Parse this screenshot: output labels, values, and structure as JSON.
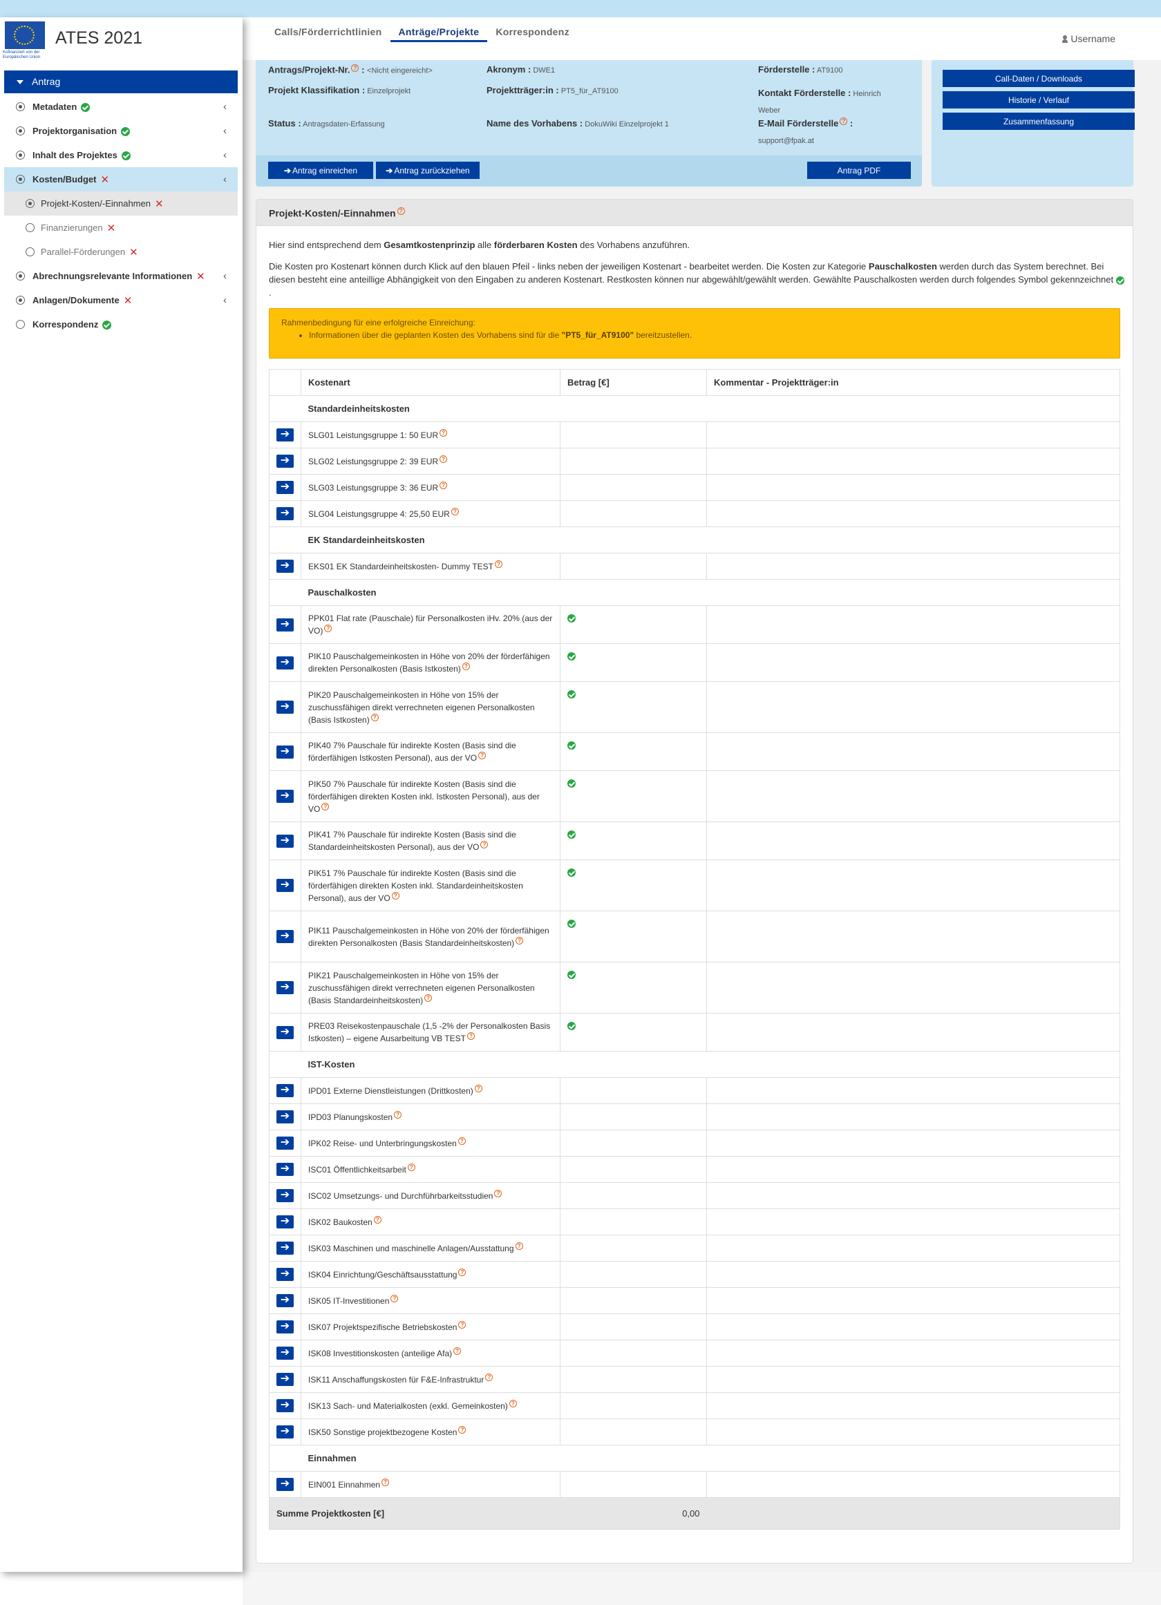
{
  "app": {
    "title": "ATES 2021",
    "logo_caption": "Kofinanziert von der Europäischen Union"
  },
  "tabs": [
    {
      "label": "Calls/Förderrichtlinien"
    },
    {
      "label": "Anträge/Projekte"
    },
    {
      "label": "Korrespondenz"
    }
  ],
  "user": {
    "name": "Username"
  },
  "sidebar": {
    "items": [
      {
        "label": "Antrag"
      },
      {
        "label": "Metadaten"
      },
      {
        "label": "Projektorganisation"
      },
      {
        "label": "Inhalt des Projektes"
      },
      {
        "label": "Kosten/Budget"
      },
      {
        "label": "Projekt-Kosten/-Einnahmen"
      },
      {
        "label": "Finanzierungen"
      },
      {
        "label": "Parallel-Förderungen"
      },
      {
        "label": "Abrechnungsrelevante Informationen"
      },
      {
        "label": "Anlagen/Dokumente"
      },
      {
        "label": "Korrespondenz"
      }
    ]
  },
  "info": {
    "antrag_nr_label": "Antrags/Projekt-Nr.",
    "antrag_nr_value": "<Nicht eingereicht>",
    "akronym_label": "Akronym :",
    "akronym_value": "DWE1",
    "foerderstelle_label": "Förderstelle :",
    "foerderstelle_value": "AT9100",
    "klassifikation_label": "Projekt Klassifikation :",
    "klassifikation_value": "Einzelprojekt",
    "traeger_label": "Projektträger:in :",
    "traeger_value": "PT5_für_AT9100",
    "kontakt_label": "Kontakt Förderstelle :",
    "kontakt_value_1": "Heinrich",
    "kontakt_value_2": "Weber",
    "status_label": "Status :",
    "status_value": "Antragsdaten-Erfassung",
    "vorhaben_label": "Name des Vorhabens :",
    "vorhaben_value": "DokuWiki Einzelprojekt 1",
    "email_label": "E-Mail Förderstelle",
    "email_value": "support@fpak.at",
    "btn_einreichen": "Antrag einreichen",
    "btn_zurueckziehen": "Antrag zurückziehen",
    "btn_pdf": "Antrag PDF",
    "side_buttons": [
      "Call-Daten / Downloads",
      "Historie / Verlauf",
      "Zusammenfassung"
    ]
  },
  "panel": {
    "title": "Projekt-Kosten/-Einnahmen",
    "intro1_a": "Hier sind entsprechend dem ",
    "intro1_b": "Gesamtkostenprinzip",
    "intro1_c": " alle ",
    "intro1_d": "förderbaren Kosten",
    "intro1_e": " des Vorhabens anzuführen.",
    "intro2_a": "Die Kosten pro Kostenart können durch Klick auf den blauen Pfeil - links neben der jeweiligen Kostenart - bearbeitet werden. Die Kosten zur Kategorie ",
    "intro2_b": "Pauschalkosten",
    "intro2_c": " werden durch das System berechnet. Bei diesen besteht eine anteillige Abhängigkeit von den Eingaben zu anderen Kostenart. Restkosten können nur abgewählt/gewählt werden. Gewählte Pauschalkosten werden durch folgendes Symbol gekennzeichnet",
    "alert_title": "Rahmenbedingung für eine erfolgreiche Einreichung:",
    "alert_item_a": "Informationen über die geplanten Kosten des Vorhabens sind für die ",
    "alert_item_b": "\"PT5_für_AT9100\"",
    "alert_item_c": " bereitzustellen."
  },
  "table": {
    "headers": [
      "Kostenart",
      "Betrag [€]",
      "Kommentar - Projektträger:in"
    ],
    "groups": [
      {
        "title": "Standardeinheitskosten",
        "rows": [
          {
            "text": "SLG01 Leistungsgruppe 1: 50 EUR",
            "ok": false
          },
          {
            "text": "SLG02 Leistungsgruppe 2: 39 EUR",
            "ok": false
          },
          {
            "text": "SLG03 Leistungsgruppe 3: 36 EUR",
            "ok": false
          },
          {
            "text": "SLG04 Leistungsgruppe 4: 25,50 EUR",
            "ok": false
          }
        ]
      },
      {
        "title": "EK Standardeinheitskosten",
        "rows": [
          {
            "text": "EKS01 EK Standardeinheitskosten- Dummy TEST",
            "ok": false
          }
        ]
      },
      {
        "title": "Pauschalkosten",
        "rows": [
          {
            "text": "PPK01 Flat rate (Pauschale) für Personalkosten iHv. 20% (aus der VO)",
            "ok": true
          },
          {
            "text": "PIK10 Pauschalgemeinkosten in Höhe von 20% der förderfähigen direkten Personalkosten (Basis Istkosten)",
            "ok": true
          },
          {
            "text": "PIK20 Pauschalgemeinkosten in Höhe von 15% der zuschussfähigen direkt verrechneten eigenen Personalkosten (Basis Istkosten)",
            "ok": true
          },
          {
            "text": "PIK40 7% Pauschale für indirekte Kosten (Basis sind die förderfähigen Istkosten Personal), aus der VO",
            "ok": true
          },
          {
            "text": "PIK50 7% Pauschale für indirekte Kosten (Basis sind die förderfähigen direkten Kosten inkl. Istkosten Personal), aus der VO",
            "ok": true
          },
          {
            "text": "PIK41 7% Pauschale für indirekte Kosten (Basis sind die Standardeinheitskosten Personal), aus der VO",
            "ok": true
          },
          {
            "text": "PIK51 7% Pauschale für indirekte Kosten (Basis sind die förderfähigen direkten Kosten inkl. Standardeinheitskosten Personal), aus der VO",
            "ok": true
          },
          {
            "text": "PIK11 Pauschalgemeinkosten in Höhe von 20% der förderfähigen direkten Personalkosten (Basis Standardeinheitskosten)",
            "ok": true
          },
          {
            "text": "PIK21 Pauschalgemeinkosten in Höhe von 15% der zuschussfähigen direkt verrechneten eigenen Personalkosten (Basis Standardeinheitskosten)",
            "ok": true
          },
          {
            "text": "PRE03 Reisekostenpauschale (1,5 -2% der Personalkosten Basis Istkosten) – eigene Ausarbeitung VB TEST",
            "ok": true
          }
        ]
      },
      {
        "title": "IST-Kosten",
        "rows": [
          {
            "text": "IPD01 Externe Dienstleistungen (Drittkosten)",
            "ok": false
          },
          {
            "text": "IPD03 Planungskosten",
            "ok": false
          },
          {
            "text": "IPK02 Reise- und Unterbringungskosten",
            "ok": false
          },
          {
            "text": "ISC01 Öffentlichkeitsarbeit",
            "ok": false
          },
          {
            "text": "ISC02 Umsetzungs- und Durchführbarkeitsstudien",
            "ok": false
          },
          {
            "text": "ISK02 Baukosten",
            "ok": false
          },
          {
            "text": "ISK03 Maschinen und maschinelle Anlagen/Ausstattung",
            "ok": false
          },
          {
            "text": "ISK04 Einrichtung/Geschäftsausstattung",
            "ok": false
          },
          {
            "text": "ISK05 IT-Investitionen",
            "ok": false
          },
          {
            "text": "ISK07 Projektspezifische Betriebskosten",
            "ok": false
          },
          {
            "text": "ISK08 Investitionskosten (anteilige Afa)",
            "ok": false
          },
          {
            "text": "ISK11 Anschaffungskosten für F&E-Infrastruktur",
            "ok": false
          },
          {
            "text": "ISK13 Sach- und Materialkosten (exkl. Gemeinkosten)",
            "ok": false
          },
          {
            "text": "ISK50 Sonstige projektbezogene Kosten",
            "ok": false
          }
        ]
      },
      {
        "title": "Einnahmen",
        "rows": [
          {
            "text": "EIN001 Einnahmen",
            "ok": false
          }
        ]
      }
    ],
    "sum_label": "Summe Projektkosten [€]",
    "sum_value": "0,00"
  }
}
